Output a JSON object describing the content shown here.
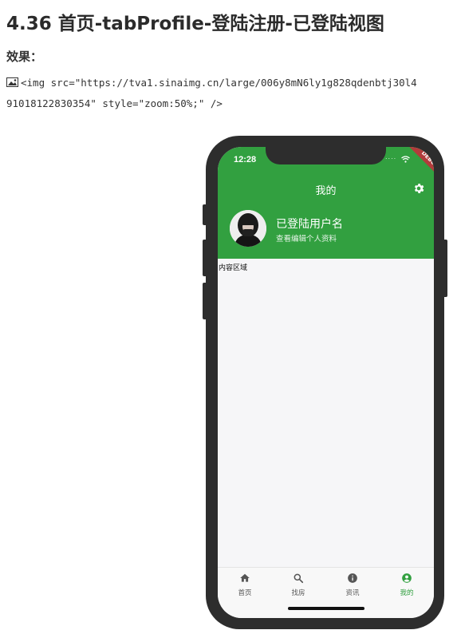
{
  "document": {
    "title": "4.36 首页-tabProfile-登陆注册-已登陆视图",
    "label": "效果：",
    "code_line_1": "<img src=\"https://tva1.sinaimg.cn/large/006y8mN6ly1g828qdenbtj30l4",
    "code_line_2": "91018122830354\" style=\"zoom:50%;\" />",
    "image_icon": "broken-image-icon"
  },
  "phone": {
    "status_time": "12:28",
    "status_signal": "....",
    "debug_banner": "DEBUG",
    "appbar_title": "我的",
    "settings_icon": "gear-icon",
    "profile": {
      "name": "已登陆用户名",
      "subtitle": "查看编辑个人资料"
    },
    "content_label": "内容区域",
    "tabs": [
      {
        "label": "首页",
        "icon": "home-icon",
        "active": false
      },
      {
        "label": "找房",
        "icon": "search-icon",
        "active": false
      },
      {
        "label": "资讯",
        "icon": "info-icon",
        "active": false
      },
      {
        "label": "我的",
        "icon": "account-circle-icon",
        "active": true
      }
    ]
  },
  "colors": {
    "primary_green": "#32a040",
    "debug_red": "#b23b3b",
    "phone_frame": "#2d2d2d",
    "screen_background": "#f6f6f8"
  }
}
